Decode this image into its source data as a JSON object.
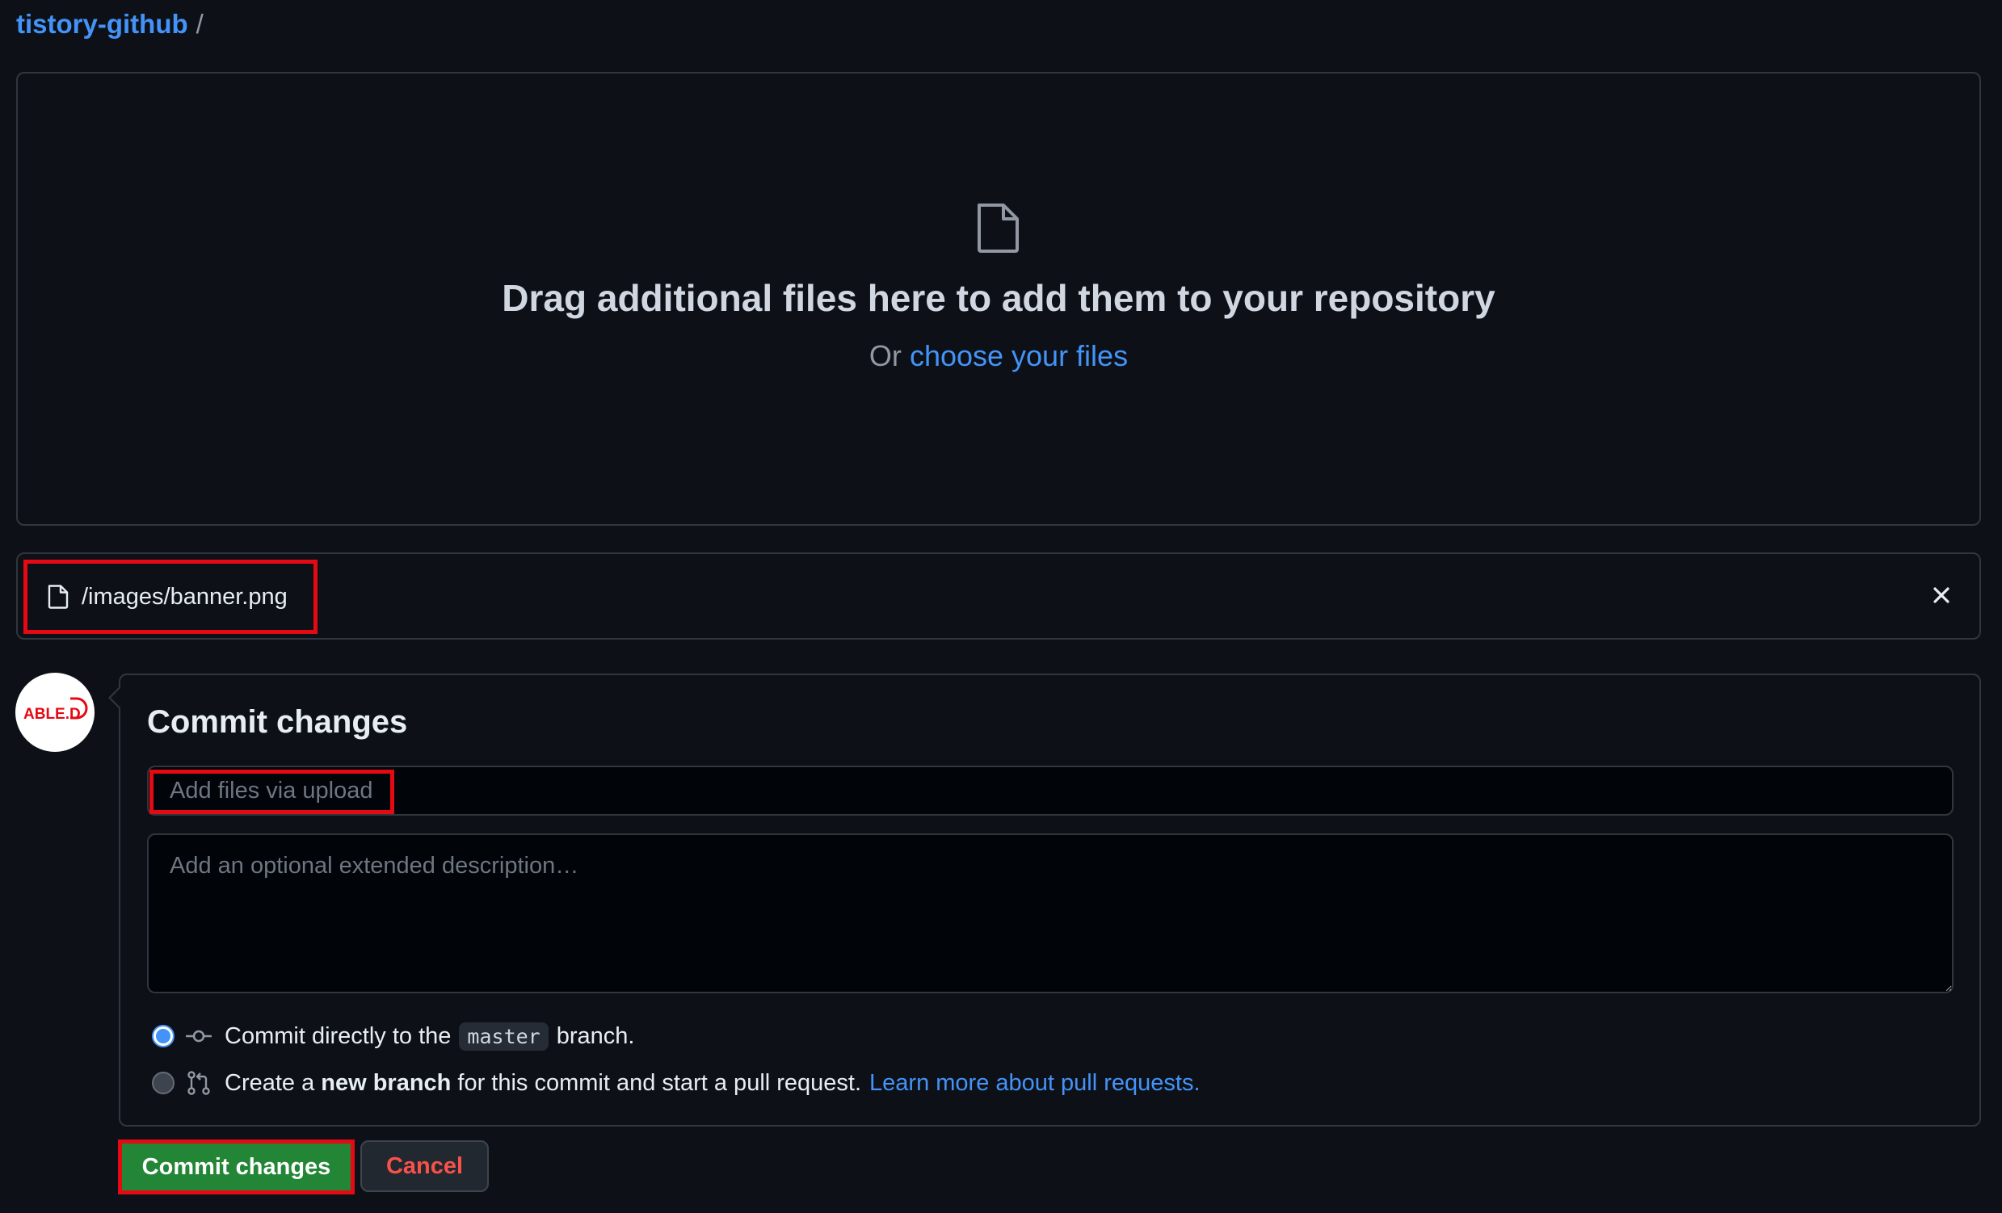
{
  "breadcrumb": {
    "repo": "tistory-github",
    "separator": "/"
  },
  "dropzone": {
    "icon": "file-icon",
    "title": "Drag additional files here to add them to your repository",
    "or_text": "Or",
    "choose_link": "choose your files"
  },
  "uploaded_file": {
    "icon": "file-icon",
    "name": "/images/banner.png",
    "remove_icon": "close-icon"
  },
  "avatar": {
    "text": "ABLE.D",
    "color": "#e50914"
  },
  "commit": {
    "title": "Commit changes",
    "summary_placeholder": "Add files via upload",
    "description_placeholder": "Add an optional extended description…",
    "options": {
      "direct": {
        "prefix": "Commit directly to the",
        "branch": "master",
        "suffix": "branch.",
        "icon": "git-commit-icon",
        "selected": true
      },
      "new_branch": {
        "prefix": "Create a",
        "bold": "new branch",
        "suffix": "for this commit and start a pull request.",
        "link": "Learn more about pull requests.",
        "icon": "git-pull-request-icon",
        "selected": false
      }
    }
  },
  "buttons": {
    "commit": "Commit changes",
    "cancel": "Cancel"
  },
  "colors": {
    "background": "#0d1117",
    "link": "#4493f8",
    "primary_button": "#238636",
    "danger_text": "#f85149",
    "highlight": "#e50914"
  }
}
